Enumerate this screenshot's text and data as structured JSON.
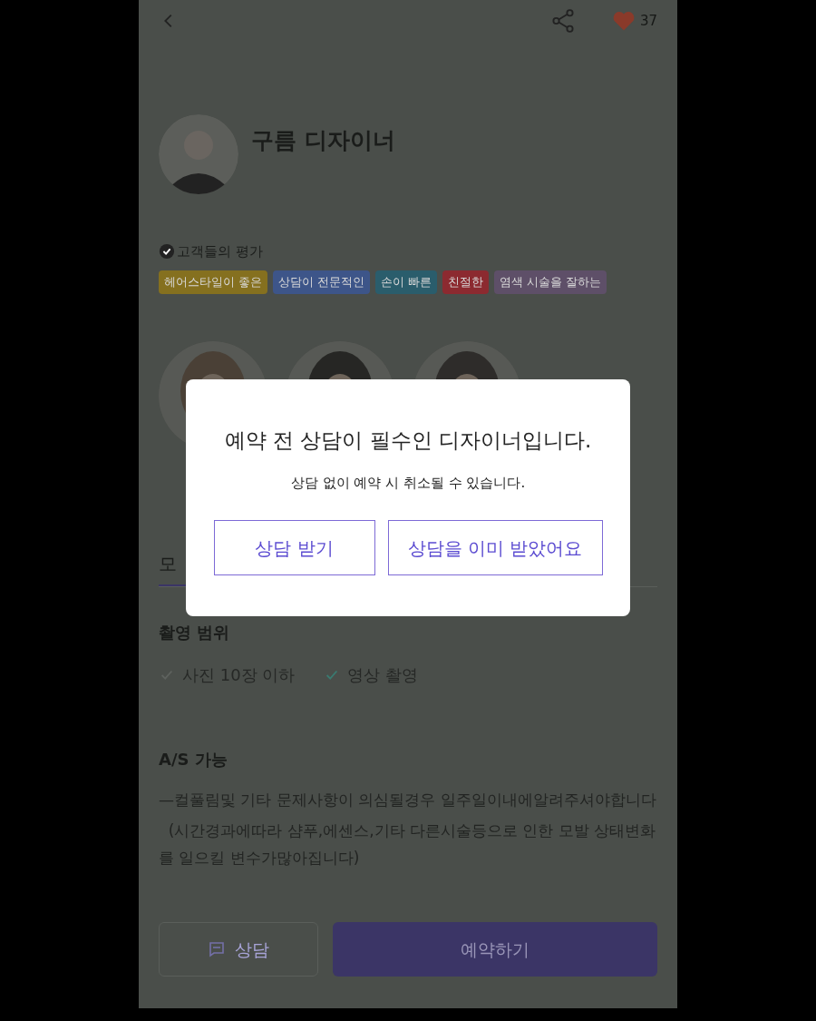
{
  "header": {
    "like_count": "37"
  },
  "designer": {
    "name": "구름 디자이너"
  },
  "reviews": {
    "title": "고객들의 평가",
    "tags": [
      {
        "label": "헤어스타일이 좋은",
        "color": "#85701f"
      },
      {
        "label": "상담이 전문적인",
        "color": "#3d5589"
      },
      {
        "label": "손이 빠른",
        "color": "#2a5d6c"
      },
      {
        "label": "친절한",
        "color": "#8c2a30"
      },
      {
        "label": "염색 시술을 잘하는",
        "color": "#5e4f68"
      }
    ]
  },
  "tabs": [
    {
      "label": "모",
      "selected": true
    }
  ],
  "scope": {
    "title": "촬영 범위",
    "items": [
      {
        "label": "사진 10장 이하",
        "checked": false
      },
      {
        "label": "영상 촬영",
        "checked": true
      }
    ]
  },
  "as": {
    "title": "A/S 가능",
    "lines": [
      "—컬풀림및 기타 문제사항이 의심될경우 일주일이내에알려주셔야합니다",
      "  (시간경과에따라 샴푸,에센스,기타 다른시술등으로 인한 모발 상태변화를 일으킬 변수가많아집니다)"
    ]
  },
  "bottom": {
    "consult": "상담",
    "reserve": "예약하기"
  },
  "dialog": {
    "title": "예약 전 상담이 필수인 디자이너입니다.",
    "message": "상담 없이 예약 시 취소될 수 있습니다.",
    "buttons": [
      "상담 받기",
      "상담을 이미 받았어요"
    ]
  }
}
